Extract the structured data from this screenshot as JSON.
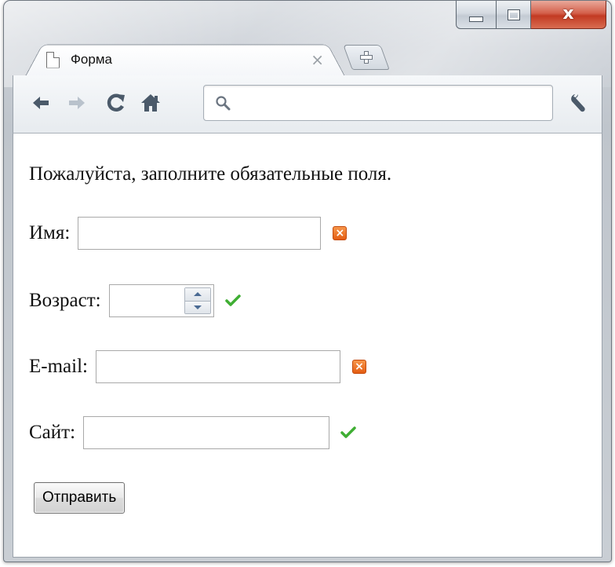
{
  "colors": {
    "invalid": "#e45d13",
    "valid": "#3fae33",
    "close_button": "#c23a22",
    "nav_icon": "#4b5a6a"
  },
  "window": {
    "caption_buttons": {
      "close_glyph": "x",
      "minimize_icon": "minimize-icon",
      "maximize_icon": "maximize-icon"
    }
  },
  "tab": {
    "title": "Форма",
    "close_glyph": "×",
    "icon": "page-icon"
  },
  "toolbar": {
    "back_icon": "arrow-left-icon",
    "forward_icon": "arrow-right-icon",
    "reload_icon": "reload-icon",
    "home_icon": "home-icon",
    "wrench_icon": "wrench-icon",
    "omnibox_value": "",
    "search_icon": "search-icon"
  },
  "page": {
    "intro": "Пожалуйста, заполните обязательные поля.",
    "fields": {
      "name": {
        "label": "Имя:",
        "value": "",
        "status": "invalid"
      },
      "age": {
        "label": "Возраст:",
        "value": "",
        "status": "valid"
      },
      "email": {
        "label": "E-mail:",
        "value": "",
        "status": "invalid"
      },
      "site": {
        "label": "Сайт:",
        "value": "",
        "status": "valid"
      }
    },
    "submit_label": "Отправить",
    "invalid_glyph": "×"
  }
}
